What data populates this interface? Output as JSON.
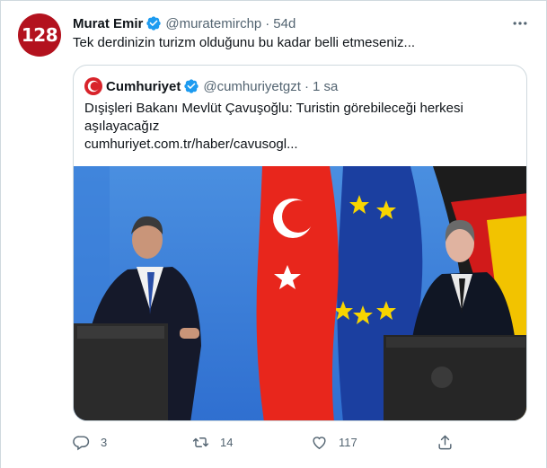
{
  "tweet": {
    "avatar_text": "128",
    "author_name": "Murat Emir",
    "handle": "@muratemirchp",
    "separator": "·",
    "time": "54d",
    "text": "Tek derdinizin turizm olduğunu bu kadar belli etmeseniz..."
  },
  "quote": {
    "source_name": "Cumhuriyet",
    "handle": "@cumhuriyetgzt",
    "separator": "·",
    "time": "1 sa",
    "text": "Dışişleri Bakanı Mevlüt Çavuşoğlu: Turistin görebileceği herkesi aşılayacağız",
    "link": "cumhuriyet.com.tr/haber/cavusogl..."
  },
  "actions": {
    "reply_count": "3",
    "retweet_count": "14",
    "like_count": "117"
  },
  "colors": {
    "accent": "#1d9bf0",
    "secondary_text": "#536471",
    "avatar_bg": "#b3121e",
    "logo_red": "#d8232a"
  },
  "icons": [
    "verified-badge-icon",
    "more-options-icon",
    "reply-icon",
    "retweet-icon",
    "like-icon",
    "share-icon"
  ]
}
